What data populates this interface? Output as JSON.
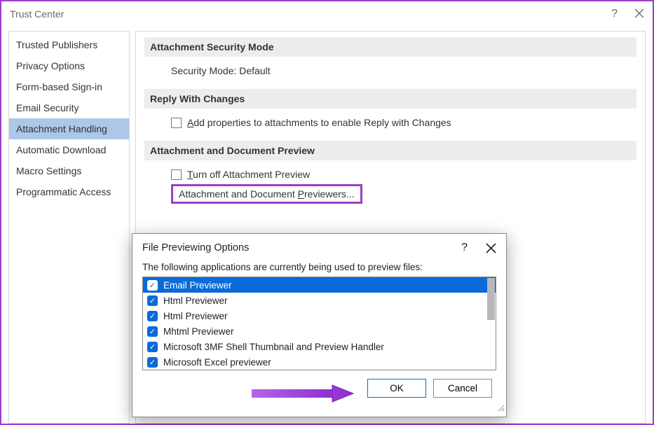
{
  "window": {
    "title": "Trust Center",
    "help": "?",
    "close": "✕"
  },
  "sidebar": {
    "items": [
      {
        "label": "Trusted Publishers"
      },
      {
        "label": "Privacy Options"
      },
      {
        "label": "Form-based Sign-in"
      },
      {
        "label": "Email Security"
      },
      {
        "label": "Attachment Handling",
        "selected": true
      },
      {
        "label": "Automatic Download"
      },
      {
        "label": "Macro Settings"
      },
      {
        "label": "Programmatic Access"
      }
    ]
  },
  "content": {
    "section1": {
      "header": "Attachment Security Mode",
      "body": "Security Mode: Default"
    },
    "section2": {
      "header": "Reply With Changes",
      "checkbox_pre": "A",
      "checkbox_post": "dd properties to attachments to enable Reply with Changes"
    },
    "section3": {
      "header": "Attachment and Document Preview",
      "checkbox_pre": "T",
      "checkbox_post": "urn off Attachment Preview",
      "button_pre": "Attachment and Document ",
      "button_u": "P",
      "button_post": "reviewers..."
    }
  },
  "inner": {
    "title": "File Previewing Options",
    "help": "?",
    "desc": "The following applications are currently being used to preview files:",
    "items": [
      {
        "label": "Email Previewer",
        "selected": true
      },
      {
        "label": "Html Previewer"
      },
      {
        "label": "Html Previewer"
      },
      {
        "label": "Mhtml Previewer"
      },
      {
        "label": "Microsoft 3MF Shell Thumbnail and Preview Handler"
      },
      {
        "label": "Microsoft Excel previewer"
      }
    ],
    "ok": "OK",
    "cancel": "Cancel"
  }
}
